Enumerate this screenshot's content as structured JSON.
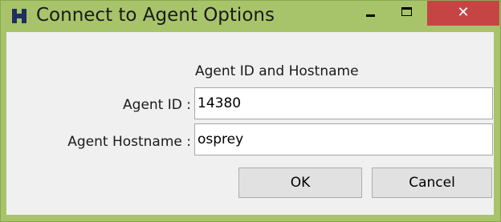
{
  "window": {
    "title": "Connect to Agent Options",
    "close_glyph": "✕",
    "icons": [
      "app-icon",
      "minimize-icon",
      "maximize-icon",
      "close-icon"
    ]
  },
  "form": {
    "group_label": "Agent ID and Hostname",
    "agent_id_label": "Agent ID :",
    "agent_id_value": "14380",
    "agent_hostname_label": "Agent Hostname :",
    "agent_hostname_value": "osprey"
  },
  "buttons": {
    "ok_label": "OK",
    "cancel_label": "Cancel"
  },
  "colors": {
    "frame": "#a8c46a",
    "close_button": "#c74444",
    "client": "#f0f0f0",
    "app_icon": "#1f2f5f"
  }
}
